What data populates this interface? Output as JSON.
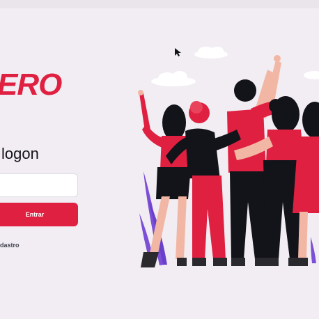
{
  "logo": {
    "text": "ERO"
  },
  "logon": {
    "title": "logon",
    "id_input": {
      "value": "",
      "placeholder": ""
    },
    "enter_button": "Entrar",
    "register_link": "dastro"
  },
  "colors": {
    "accent": "#e02041",
    "background": "#f1edf3",
    "text": "#13131a",
    "link_text": "#41414d",
    "plant": "#7b4fd6"
  },
  "illustration": {
    "name": "heroes-group-illustration"
  },
  "icons": {
    "cursor": "mouse-cursor-icon"
  }
}
